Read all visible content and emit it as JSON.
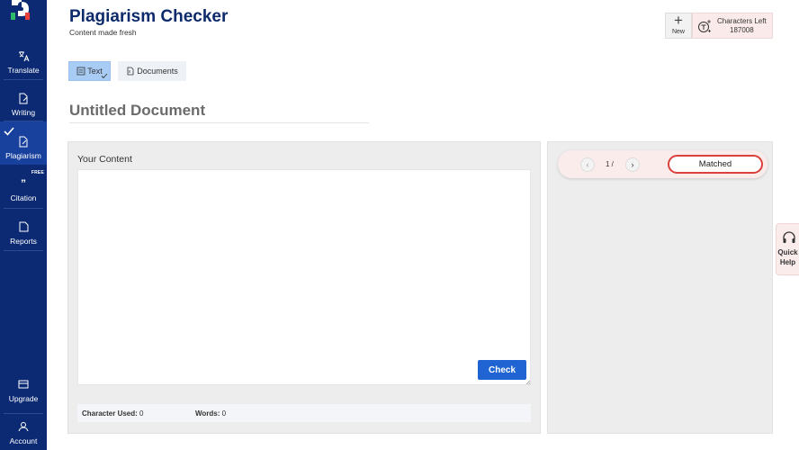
{
  "sidebar": {
    "items": [
      {
        "label": "Translate",
        "icon": "translate-icon"
      },
      {
        "label": "Writing",
        "icon": "writing-icon"
      },
      {
        "label": "Plagiarism",
        "icon": "plagiarism-icon",
        "active": true
      },
      {
        "label": "Citation",
        "icon": "citation-icon",
        "badge": "FREE"
      },
      {
        "label": "Reports",
        "icon": "reports-icon"
      }
    ],
    "bottom_items": [
      {
        "label": "Upgrade",
        "icon": "card-icon"
      },
      {
        "label": "Account",
        "icon": "account-icon"
      }
    ]
  },
  "header": {
    "title": "Plagiarism Checker",
    "subtitle": "Content made fresh",
    "new_label": "New",
    "chars_left_label": "Characters Left",
    "chars_left_value": "187008"
  },
  "tabs": [
    {
      "label": "Text",
      "active": true
    },
    {
      "label": "Documents",
      "active": false
    }
  ],
  "document": {
    "title": "Untitled Document"
  },
  "content": {
    "label": "Your Content",
    "editor_value": "",
    "check_label": "Check",
    "chars_used_label": "Character Used:",
    "chars_used_value": "0",
    "words_label": "Words:",
    "words_value": "0"
  },
  "results": {
    "pager_text": "1 /",
    "matched_label": "Matched"
  },
  "quick_help": {
    "line1": "Quick",
    "line2": "Help"
  },
  "colors": {
    "sidebar_bg": "#0b2a73",
    "sidebar_active": "#17419d",
    "accent_blue": "#1f64d2",
    "title_navy": "#0d2a6b",
    "matched_border": "#d9413a",
    "tab_active": "#a9ccf5"
  }
}
